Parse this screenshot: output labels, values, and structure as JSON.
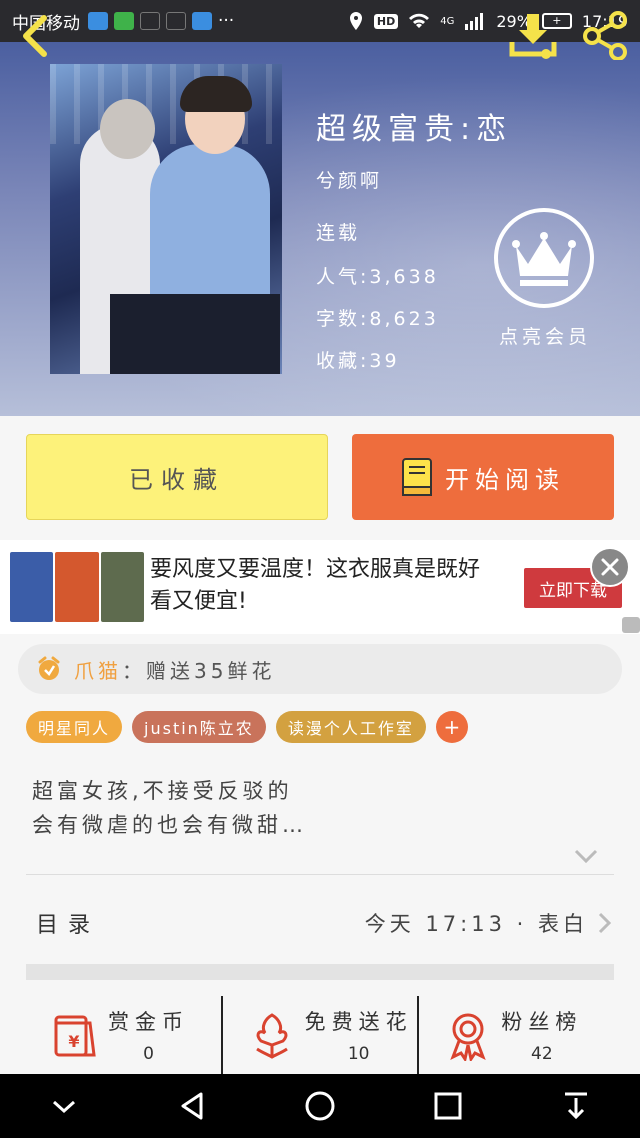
{
  "status_bar": {
    "carrier": "中国移动",
    "dots": "···",
    "hd": "HD",
    "net": "4G",
    "battery_percent": "29%",
    "time": "17:19"
  },
  "book": {
    "title": "超级富贵:恋",
    "author": "兮颜啊",
    "status": "连载",
    "popularity": "人气:3,638",
    "word_count": "字数:8,623",
    "favorites": "收藏:39",
    "vip_label": "点亮会员"
  },
  "actions": {
    "collect_label": "已收藏",
    "read_label": "开始阅读"
  },
  "ad": {
    "text": "要风度又要温度！这衣服真是既好看又便宜!",
    "cta": "立即下载",
    "image_colors": [
      "#3b5da8",
      "#d4582e",
      "#5e6b4e"
    ]
  },
  "gift": {
    "user": "爪猫",
    "message": "：赠送35鲜花"
  },
  "tags": [
    "明星同人",
    "justin陈立农",
    "读漫个人工作室"
  ],
  "tag_add": "+",
  "synopsis": "超富女孩,不接受反驳的\n会有微虐的也会有微甜…",
  "toc": {
    "label": "目录",
    "latest": "今天 17:13 · 表白"
  },
  "stats": [
    {
      "label": "赏金币",
      "value": "0",
      "icon": "gold-coin-icon"
    },
    {
      "label": "免费送花",
      "value": "10",
      "icon": "flower-icon"
    },
    {
      "label": "粉丝榜",
      "value": "42",
      "icon": "medal-icon"
    }
  ],
  "colors": {
    "accent_orange": "#ee6d3d",
    "collect_yellow": "#fdf27a",
    "icon_red": "#d9432f"
  }
}
